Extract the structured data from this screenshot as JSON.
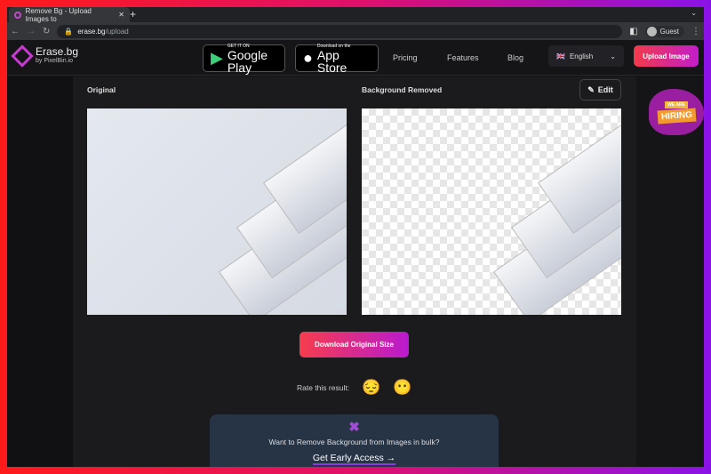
{
  "browser": {
    "tab_title": "Remove Bg - Upload Images to",
    "url_domain": "erase.bg",
    "url_path": "/upload",
    "profile": "Guest"
  },
  "header": {
    "logo_name": "Erase.bg",
    "logo_sub": "by PixelBin.io",
    "google": {
      "small": "GET IT ON",
      "big": "Google Play"
    },
    "apple": {
      "small": "Download on the",
      "big": "App Store"
    },
    "nav": [
      "Pricing",
      "Features",
      "Blog"
    ],
    "language": "English",
    "upload": "Upload Image"
  },
  "main": {
    "original_label": "Original",
    "removed_label": "Background Removed",
    "edit": "Edit",
    "download": "Download Original Size",
    "rate_label": "Rate this result:",
    "rate_emojis": [
      "😔",
      "😶"
    ],
    "bulk_question": "Want to Remove Background from Images in bulk?",
    "bulk_cta": "Get Early Access →"
  },
  "side": {
    "badge_top": "WE ARE",
    "badge": "HIRING"
  },
  "colors": {
    "accent_start": "#f33a4a",
    "accent_end": "#c21dcb"
  }
}
